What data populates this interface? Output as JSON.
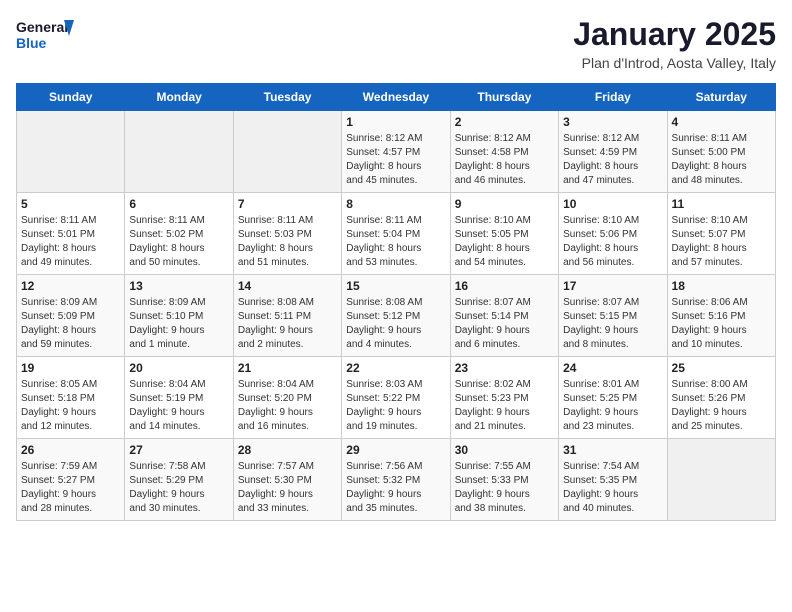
{
  "header": {
    "logo_line1": "General",
    "logo_line2": "Blue",
    "title": "January 2025",
    "subtitle": "Plan d'Introd, Aosta Valley, Italy"
  },
  "days_of_week": [
    "Sunday",
    "Monday",
    "Tuesday",
    "Wednesday",
    "Thursday",
    "Friday",
    "Saturday"
  ],
  "weeks": [
    [
      {
        "day": "",
        "info": ""
      },
      {
        "day": "",
        "info": ""
      },
      {
        "day": "",
        "info": ""
      },
      {
        "day": "1",
        "info": "Sunrise: 8:12 AM\nSunset: 4:57 PM\nDaylight: 8 hours\nand 45 minutes."
      },
      {
        "day": "2",
        "info": "Sunrise: 8:12 AM\nSunset: 4:58 PM\nDaylight: 8 hours\nand 46 minutes."
      },
      {
        "day": "3",
        "info": "Sunrise: 8:12 AM\nSunset: 4:59 PM\nDaylight: 8 hours\nand 47 minutes."
      },
      {
        "day": "4",
        "info": "Sunrise: 8:11 AM\nSunset: 5:00 PM\nDaylight: 8 hours\nand 48 minutes."
      }
    ],
    [
      {
        "day": "5",
        "info": "Sunrise: 8:11 AM\nSunset: 5:01 PM\nDaylight: 8 hours\nand 49 minutes."
      },
      {
        "day": "6",
        "info": "Sunrise: 8:11 AM\nSunset: 5:02 PM\nDaylight: 8 hours\nand 50 minutes."
      },
      {
        "day": "7",
        "info": "Sunrise: 8:11 AM\nSunset: 5:03 PM\nDaylight: 8 hours\nand 51 minutes."
      },
      {
        "day": "8",
        "info": "Sunrise: 8:11 AM\nSunset: 5:04 PM\nDaylight: 8 hours\nand 53 minutes."
      },
      {
        "day": "9",
        "info": "Sunrise: 8:10 AM\nSunset: 5:05 PM\nDaylight: 8 hours\nand 54 minutes."
      },
      {
        "day": "10",
        "info": "Sunrise: 8:10 AM\nSunset: 5:06 PM\nDaylight: 8 hours\nand 56 minutes."
      },
      {
        "day": "11",
        "info": "Sunrise: 8:10 AM\nSunset: 5:07 PM\nDaylight: 8 hours\nand 57 minutes."
      }
    ],
    [
      {
        "day": "12",
        "info": "Sunrise: 8:09 AM\nSunset: 5:09 PM\nDaylight: 8 hours\nand 59 minutes."
      },
      {
        "day": "13",
        "info": "Sunrise: 8:09 AM\nSunset: 5:10 PM\nDaylight: 9 hours\nand 1 minute."
      },
      {
        "day": "14",
        "info": "Sunrise: 8:08 AM\nSunset: 5:11 PM\nDaylight: 9 hours\nand 2 minutes."
      },
      {
        "day": "15",
        "info": "Sunrise: 8:08 AM\nSunset: 5:12 PM\nDaylight: 9 hours\nand 4 minutes."
      },
      {
        "day": "16",
        "info": "Sunrise: 8:07 AM\nSunset: 5:14 PM\nDaylight: 9 hours\nand 6 minutes."
      },
      {
        "day": "17",
        "info": "Sunrise: 8:07 AM\nSunset: 5:15 PM\nDaylight: 9 hours\nand 8 minutes."
      },
      {
        "day": "18",
        "info": "Sunrise: 8:06 AM\nSunset: 5:16 PM\nDaylight: 9 hours\nand 10 minutes."
      }
    ],
    [
      {
        "day": "19",
        "info": "Sunrise: 8:05 AM\nSunset: 5:18 PM\nDaylight: 9 hours\nand 12 minutes."
      },
      {
        "day": "20",
        "info": "Sunrise: 8:04 AM\nSunset: 5:19 PM\nDaylight: 9 hours\nand 14 minutes."
      },
      {
        "day": "21",
        "info": "Sunrise: 8:04 AM\nSunset: 5:20 PM\nDaylight: 9 hours\nand 16 minutes."
      },
      {
        "day": "22",
        "info": "Sunrise: 8:03 AM\nSunset: 5:22 PM\nDaylight: 9 hours\nand 19 minutes."
      },
      {
        "day": "23",
        "info": "Sunrise: 8:02 AM\nSunset: 5:23 PM\nDaylight: 9 hours\nand 21 minutes."
      },
      {
        "day": "24",
        "info": "Sunrise: 8:01 AM\nSunset: 5:25 PM\nDaylight: 9 hours\nand 23 minutes."
      },
      {
        "day": "25",
        "info": "Sunrise: 8:00 AM\nSunset: 5:26 PM\nDaylight: 9 hours\nand 25 minutes."
      }
    ],
    [
      {
        "day": "26",
        "info": "Sunrise: 7:59 AM\nSunset: 5:27 PM\nDaylight: 9 hours\nand 28 minutes."
      },
      {
        "day": "27",
        "info": "Sunrise: 7:58 AM\nSunset: 5:29 PM\nDaylight: 9 hours\nand 30 minutes."
      },
      {
        "day": "28",
        "info": "Sunrise: 7:57 AM\nSunset: 5:30 PM\nDaylight: 9 hours\nand 33 minutes."
      },
      {
        "day": "29",
        "info": "Sunrise: 7:56 AM\nSunset: 5:32 PM\nDaylight: 9 hours\nand 35 minutes."
      },
      {
        "day": "30",
        "info": "Sunrise: 7:55 AM\nSunset: 5:33 PM\nDaylight: 9 hours\nand 38 minutes."
      },
      {
        "day": "31",
        "info": "Sunrise: 7:54 AM\nSunset: 5:35 PM\nDaylight: 9 hours\nand 40 minutes."
      },
      {
        "day": "",
        "info": ""
      }
    ]
  ]
}
